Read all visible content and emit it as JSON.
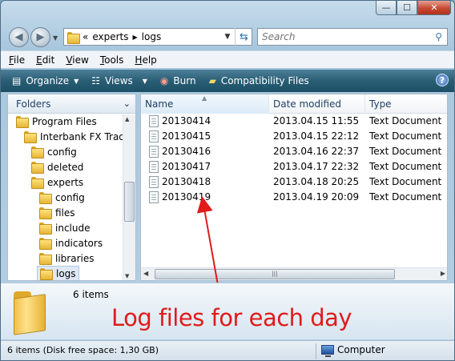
{
  "window": {
    "caption": {
      "minimize": "—",
      "maximize": "☐",
      "close": "✕"
    }
  },
  "address": {
    "overflow": "«",
    "segments": [
      "experts",
      "logs"
    ],
    "search_placeholder": "Search"
  },
  "menu": [
    "File",
    "Edit",
    "View",
    "Tools",
    "Help"
  ],
  "commands": [
    {
      "label": "Organize",
      "icon": "organize-icon",
      "dropdown": true
    },
    {
      "label": "Views",
      "icon": "views-icon",
      "dropdown": true
    },
    {
      "label": "Burn",
      "icon": "burn-icon",
      "dropdown": false
    },
    {
      "label": "Compatibility Files",
      "icon": "folder-icon",
      "dropdown": false
    }
  ],
  "help_label": "?",
  "folders": {
    "title": "Folders",
    "items": [
      {
        "label": "Program Files",
        "depth": 0
      },
      {
        "label": "Interbank FX Trader",
        "depth": 1
      },
      {
        "label": "config",
        "depth": 2
      },
      {
        "label": "deleted",
        "depth": 2
      },
      {
        "label": "experts",
        "depth": 2
      },
      {
        "label": "config",
        "depth": 3
      },
      {
        "label": "files",
        "depth": 3
      },
      {
        "label": "include",
        "depth": 3
      },
      {
        "label": "indicators",
        "depth": 3
      },
      {
        "label": "libraries",
        "depth": 3
      },
      {
        "label": "logs",
        "depth": 3,
        "selected": true
      }
    ]
  },
  "list": {
    "columns": [
      "Name",
      "Date modified",
      "Type"
    ],
    "rows": [
      {
        "name": "20130414",
        "date": "2013.04.15 11:55",
        "type": "Text Document"
      },
      {
        "name": "20130415",
        "date": "2013.04.15 22:12",
        "type": "Text Document"
      },
      {
        "name": "20130416",
        "date": "2013.04.16 22:37",
        "type": "Text Document"
      },
      {
        "name": "20130417",
        "date": "2013.04.17 22:32",
        "type": "Text Document"
      },
      {
        "name": "20130418",
        "date": "2013.04.18 20:25",
        "type": "Text Document"
      },
      {
        "name": "20130419",
        "date": "2013.04.19 20:09",
        "type": "Text Document"
      }
    ]
  },
  "details": {
    "count": "6 items",
    "annotation": "Log files for each day"
  },
  "status": {
    "text": "6 items (Disk free space: 1,30 GB)",
    "location": "Computer"
  },
  "colors": {
    "annotation": "#e11a1a",
    "command_bar": "#2a5e75"
  }
}
